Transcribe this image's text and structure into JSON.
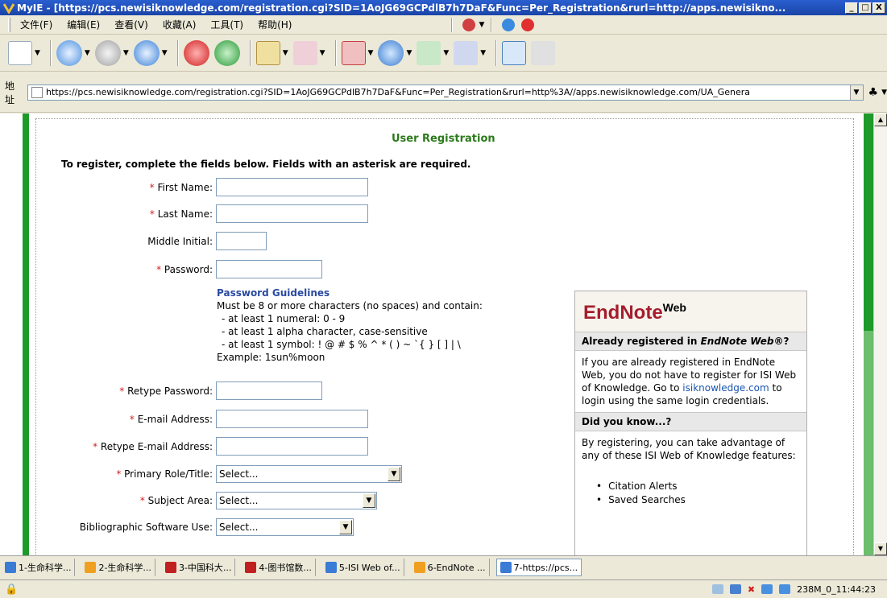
{
  "window": {
    "title": "MyIE - [https://pcs.newisiknowledge.com/registration.cgi?SID=1AoJG69GCPdlB7h7DaF&Func=Per_Registration&rurl=http://apps.newisikno...",
    "min": "_",
    "max": "□",
    "close": "X"
  },
  "menu": [
    "文件(F)",
    "编辑(E)",
    "查看(V)",
    "收藏(A)",
    "工具(T)",
    "帮助(H)"
  ],
  "address": {
    "label": "地址",
    "url": "https://pcs.newisiknowledge.com/registration.cgi?SID=1AoJG69GCPdlB7h7DaF&Func=Per_Registration&rurl=http%3A//apps.newisiknowledge.com/UA_Genera"
  },
  "form": {
    "heading": "User Registration",
    "intro": "To register, complete the fields below.  Fields with an asterisk are required.",
    "required_mark": "*",
    "first_name": "First Name:",
    "last_name": "Last Name:",
    "middle_initial": "Middle Initial:",
    "password": "Password:",
    "retype_password": "Retype Password:",
    "email": "E-mail Address:",
    "retype_email": "Retype E-mail Address:",
    "primary_role": "Primary Role/Title:",
    "subject_area": "Subject Area:",
    "biblio": "Bibliographic Software Use:",
    "select_placeholder": "Select..."
  },
  "guidelines": {
    "title": "Password Guidelines",
    "line1": "Must be 8 or more characters (no spaces) and contain:",
    "line2": "- at least 1 numeral: 0 - 9",
    "line3": "- at least 1 alpha character, case-sensitive",
    "line4": "- at least 1 symbol: ! @ # $ % ^ * ( ) ~ `{ } [ ] | \\",
    "line5": "Example: 1sun%moon"
  },
  "endnote": {
    "logo": "EndNote",
    "logo_suffix": "Web",
    "header1_a": "Already registered in ",
    "header1_b": "EndNote Web",
    "header1_c": "®?",
    "text1_a": "If you are already registered in EndNote Web, you do not have to register for ISI Web of Knowledge. Go to ",
    "text1_link": "isiknowledge.com",
    "text1_b": " to login using the same login credentials.",
    "header2": "Did you know...?",
    "text2": "By registering, you can take advantage of any of these ISI Web of Knowledge features:",
    "features": [
      "Citation Alerts",
      "Saved Searches"
    ]
  },
  "tabs": [
    {
      "label": "1-生命科学...",
      "color": "#3a7bd5"
    },
    {
      "label": "2-生命科学...",
      "color": "#f0a020"
    },
    {
      "label": "3-中国科大...",
      "color": "#c02020"
    },
    {
      "label": "4-图书馆数...",
      "color": "#c02020"
    },
    {
      "label": "5-ISI Web of...",
      "color": "#3a7bd5"
    },
    {
      "label": "6-EndNote ...",
      "color": "#f0a020"
    },
    {
      "label": "7-https://pcs...",
      "color": "#3a7bd5"
    }
  ],
  "status": {
    "right_text": "238M_0_11:44:23"
  }
}
